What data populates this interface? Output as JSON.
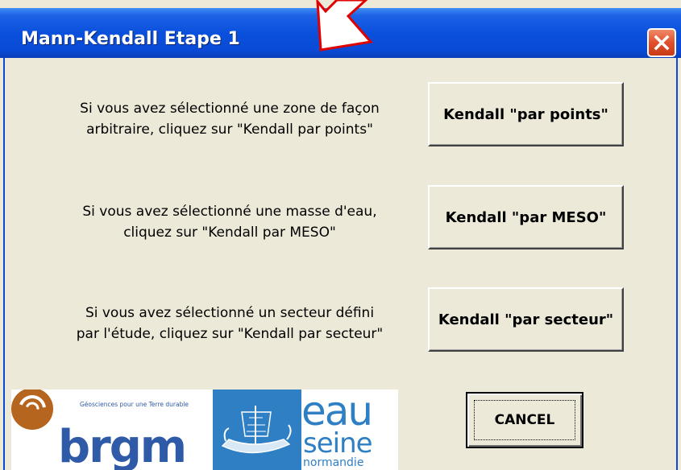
{
  "window": {
    "title": "Mann-Kendall Etape 1",
    "title_bar_color": "#0a4ad6",
    "close_icon": "close-icon"
  },
  "rows": [
    {
      "text": [
        "Si vous avez sélectionné une zone de façon",
        "arbitraire, cliquez sur \"Kendall par points\""
      ],
      "button": "Kendall \"par points\""
    },
    {
      "text": [
        "Si vous avez sélectionné une masse d'eau,",
        "cliquez sur \"Kendall par MESO\""
      ],
      "button": "Kendall \"par MESO\""
    },
    {
      "text": [
        "Si vous avez sélectionné un secteur défini",
        "par l'étude, cliquez sur \"Kendall par secteur\""
      ],
      "button": "Kendall \"par secteur\""
    }
  ],
  "cancel_label": "CANCEL",
  "logos": {
    "brgm": {
      "name": "brgm",
      "tagline": "Géosciences pour une Terre durable",
      "color": "#2e5aa7",
      "accent": "#b5651d"
    },
    "eau": {
      "line1": "eau",
      "line2": "seine",
      "line3": "normandie",
      "color": "#2f7fc4"
    }
  },
  "annotation_color": "#e00000"
}
